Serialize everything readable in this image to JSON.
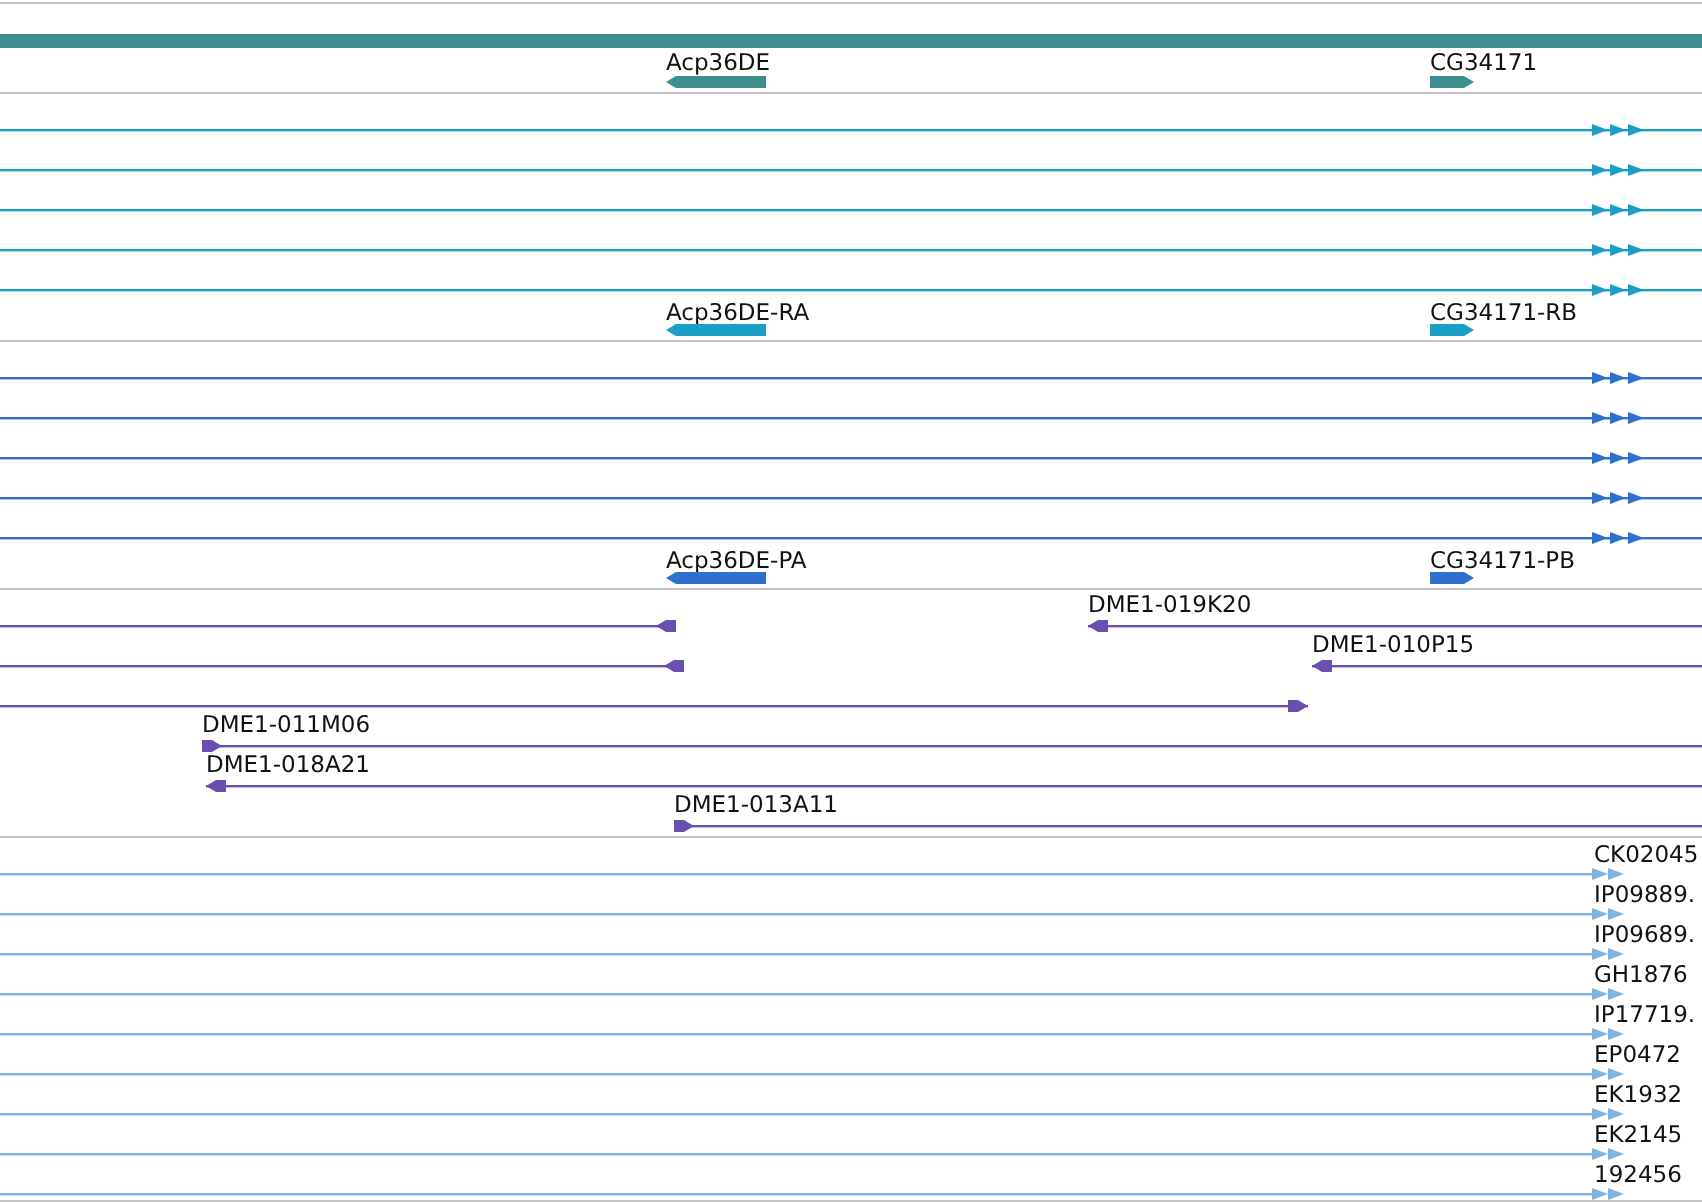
{
  "tracks": [
    {
      "kind": "genes",
      "color": "#3d8f8f",
      "features": [
        {
          "label": "Acp36DE",
          "reverse": true
        },
        {
          "label": "CG34171",
          "reverse": false
        }
      ]
    },
    {
      "kind": "transcripts",
      "color": "#1aa0c4",
      "rows": [
        {
          "reverse": false
        },
        {
          "reverse": false
        },
        {
          "reverse": false
        },
        {
          "reverse": false
        },
        {
          "reverse": false
        }
      ],
      "features": [
        {
          "label": "Acp36DE-RA",
          "reverse": true
        },
        {
          "label": "CG34171-RB",
          "reverse": false
        }
      ]
    },
    {
      "kind": "transcripts",
      "color": "#2f6fd0",
      "rows": [
        {
          "reverse": false
        },
        {
          "reverse": false
        },
        {
          "reverse": false
        },
        {
          "reverse": false
        },
        {
          "reverse": false
        }
      ],
      "features": [
        {
          "label": "Acp36DE-PA",
          "reverse": true
        },
        {
          "label": "CG34171-PB",
          "reverse": false
        }
      ]
    },
    {
      "kind": "clones",
      "color": "#6a4fb0",
      "features": [
        {
          "reverse": true
        },
        {
          "label": "DME1-019K20",
          "reverse": true
        },
        {
          "reverse": true
        },
        {
          "label": "DME1-010P15",
          "reverse": true
        },
        {
          "reverse": false
        },
        {
          "label": "DME1-011M06",
          "reverse": false
        },
        {
          "label": "DME1-018A21",
          "reverse": true
        },
        {
          "label": "DME1-013A11",
          "reverse": false
        }
      ]
    },
    {
      "kind": "ests",
      "color": "#7fb5e0",
      "features": [
        {
          "label": "CK02045",
          "reverse": false
        },
        {
          "label": "IP09889.",
          "reverse": false
        },
        {
          "label": "IP09689.",
          "reverse": false
        },
        {
          "label": "GH1876",
          "reverse": false
        },
        {
          "label": "IP17719.",
          "reverse": false
        },
        {
          "label": "EP0472",
          "reverse": false
        },
        {
          "label": "EK1932",
          "reverse": false
        },
        {
          "label": "EK2145",
          "reverse": false
        },
        {
          "label": "192456",
          "reverse": false
        }
      ]
    }
  ]
}
